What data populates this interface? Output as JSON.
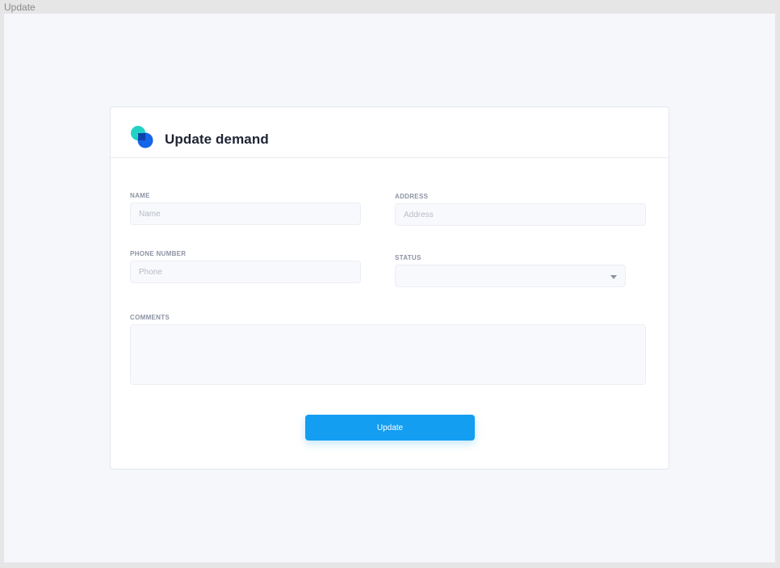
{
  "frame": {
    "title": "Update"
  },
  "form": {
    "title": "Update demand",
    "fields": {
      "name": {
        "label": "NAME",
        "placeholder": "Name",
        "value": ""
      },
      "address": {
        "label": "ADDRESS",
        "placeholder": "Address",
        "value": ""
      },
      "phone": {
        "label": "PHONE NUMBER",
        "placeholder": "Phone",
        "value": ""
      },
      "status": {
        "label": "STATUS",
        "selected": ""
      },
      "comments": {
        "label": "COMMENTS",
        "placeholder": "",
        "value": ""
      }
    },
    "submit_label": "Update"
  },
  "icons": {
    "logo": "overlapping-circles-logo-icon",
    "status_dropdown": "caret-down-icon"
  },
  "colors": {
    "accent": "#139ef2",
    "logo_teal": "#22d3c5",
    "logo_blue": "#1565e8",
    "logo_overlap": "#0f3fa8",
    "background": "#f5f7fb"
  }
}
